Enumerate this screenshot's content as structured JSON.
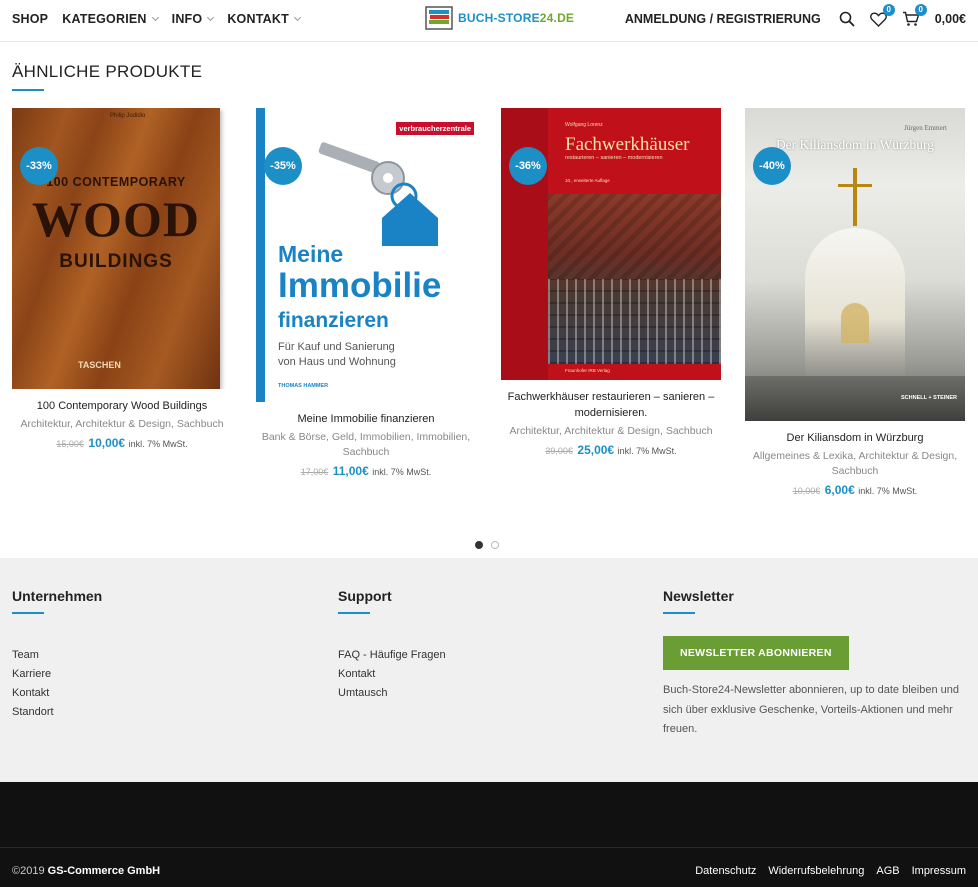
{
  "header": {
    "nav": [
      {
        "label": "SHOP",
        "dropdown": false
      },
      {
        "label": "KATEGORIEN",
        "dropdown": true
      },
      {
        "label": "INFO",
        "dropdown": true
      },
      {
        "label": "KONTAKT",
        "dropdown": true
      }
    ],
    "logo_text_a": "BUCH-STORE",
    "logo_text_b": "24.DE",
    "login_label": "ANMELDUNG / REGISTRIERUNG",
    "search_icon": "search-icon",
    "wishlist_count": "0",
    "cart_count": "0",
    "cart_total": "0,00€"
  },
  "section": {
    "title": "ÄHNLICHE PRODUKTE"
  },
  "products": [
    {
      "badge": "-33%",
      "cover": {
        "author": "Philip Jodidio",
        "line1": "100 CONTEMPORARY",
        "line2": "WOOD",
        "line3": "BUILDINGS",
        "publisher": "TASCHEN"
      },
      "name": "100 Contemporary Wood Buildings",
      "categories": "Architektur, Architektur & Design, Sachbuch",
      "old_price": "15,00€",
      "new_price": "10,00€",
      "tax": "inkl. 7% MwSt."
    },
    {
      "badge": "-35%",
      "cover": {
        "brand": "verbraucherzentrale",
        "line1": "Meine",
        "line2": "Immobilie",
        "line3": "finanzieren",
        "sub1": "Für Kauf und Sanierung",
        "sub2": "von Haus und Wohnung",
        "author": "THOMAS HAMMER"
      },
      "name": "Meine Immobilie finanzieren",
      "categories": "Bank & Börse, Geld, Immobilien, Immobilien, Sachbuch",
      "old_price": "17,00€",
      "new_price": "11,00€",
      "tax": "inkl. 7% MwSt."
    },
    {
      "badge": "-36%",
      "cover": {
        "author": "Wolfgang Lorenz",
        "title": "Fachwerkhäuser",
        "sub": "restaurieren – sanieren – modernisieren",
        "edition": "10., erweiterte Auflage",
        "publisher": "Fraunhofer IRB Verlag"
      },
      "name": "Fachwerkhäuser restaurieren – sanieren – modernisieren.",
      "categories": "Architektur, Architektur & Design, Sachbuch",
      "old_price": "39,00€",
      "new_price": "25,00€",
      "tax": "inkl. 7% MwSt."
    },
    {
      "badge": "-40%",
      "cover": {
        "author": "Jürgen Emmert",
        "title": "Der Kiliansdom in Würzburg",
        "publisher": "SCHNELL + STEINER"
      },
      "name": "Der Kiliansdom in Würzburg",
      "categories": "Allgemeines & Lexika, Architektur & Design, Sachbuch",
      "old_price": "10,00€",
      "new_price": "6,00€",
      "tax": "inkl. 7% MwSt."
    }
  ],
  "pagination": {
    "pages": 2,
    "active": 1
  },
  "footer": {
    "col1": {
      "heading": "Unternehmen",
      "links": [
        "Team",
        "Karriere",
        "Kontakt",
        "Standort"
      ]
    },
    "col2": {
      "heading": "Support",
      "links": [
        "FAQ - Häufige Fragen",
        "Kontakt",
        "Umtausch"
      ]
    },
    "col3": {
      "heading": "Newsletter",
      "button": "NEWSLETTER ABONNIEREN",
      "text": "Buch-Store24-Newsletter abonnieren, up to date bleiben und sich über exklusive Geschenke, Vorteils-Aktionen und mehr freuen."
    },
    "copyright_prefix": "©2019",
    "copyright_company": "GS-Commerce GmbH",
    "legal_links": [
      "Datenschutz",
      "Widerrufsbelehrung",
      "AGB",
      "Impressum"
    ]
  },
  "colors": {
    "accent": "#1d8fc7",
    "newsletter_button": "#6a9e35",
    "footer_bg": "#f0f0f0",
    "bottom_bar": "#111111"
  }
}
